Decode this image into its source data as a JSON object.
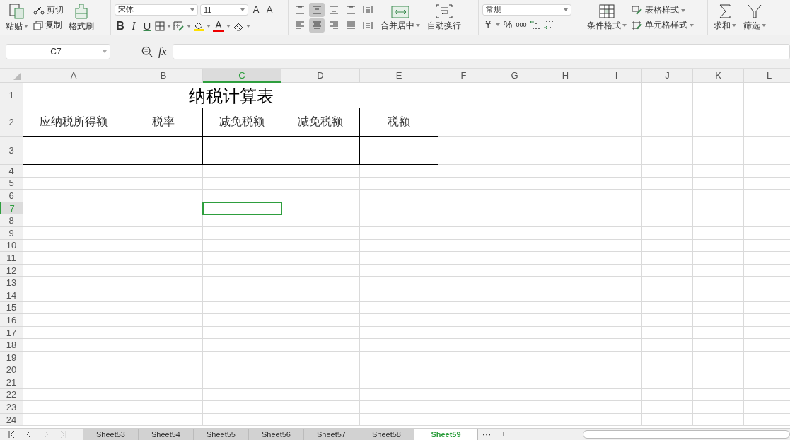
{
  "ribbon": {
    "paste": "粘贴",
    "cut": "剪切",
    "copy": "复制",
    "format_painter": "格式刷",
    "font_name": "宋体",
    "font_size": "11",
    "grow_font": "A",
    "shrink_font": "A",
    "bold": "B",
    "italic": "I",
    "underline": "U",
    "font_color": "A",
    "alignment": [
      {
        "selected": false
      },
      {
        "selected": true
      },
      {
        "selected": false
      },
      {
        "selected": false
      },
      {
        "selected": false
      },
      {
        "selected": false
      },
      {
        "selected": true
      },
      {
        "selected": false
      },
      {
        "selected": false
      },
      {
        "selected": false
      }
    ],
    "merge": "合并居中",
    "wrap": "自动换行",
    "number_format": "常规",
    "currency": "￥",
    "percent": "%",
    "thousands": "000",
    "conditional_format": "条件格式",
    "table_style": "表格样式",
    "cell_style": "单元格样式",
    "sum": "求和",
    "filter": "筛选"
  },
  "formula_bar": {
    "name_box": "C7",
    "fx": "fx"
  },
  "columns": [
    {
      "label": "A",
      "selected": false
    },
    {
      "label": "B",
      "selected": false
    },
    {
      "label": "C",
      "selected": true
    },
    {
      "label": "D",
      "selected": false
    },
    {
      "label": "E",
      "selected": false
    },
    {
      "label": "F",
      "selected": false
    },
    {
      "label": "G",
      "selected": false
    },
    {
      "label": "H",
      "selected": false
    },
    {
      "label": "I",
      "selected": false
    },
    {
      "label": "J",
      "selected": false
    },
    {
      "label": "K",
      "selected": false
    },
    {
      "label": "L",
      "selected": false
    }
  ],
  "rows": [
    {
      "label": "1",
      "selected": false
    },
    {
      "label": "2",
      "selected": false
    },
    {
      "label": "3",
      "selected": false
    },
    {
      "label": "4",
      "selected": false
    },
    {
      "label": "5",
      "selected": false
    },
    {
      "label": "6",
      "selected": false
    },
    {
      "label": "7",
      "selected": true
    },
    {
      "label": "8",
      "selected": false
    },
    {
      "label": "9",
      "selected": false
    },
    {
      "label": "10",
      "selected": false
    },
    {
      "label": "11",
      "selected": false
    },
    {
      "label": "12",
      "selected": false
    },
    {
      "label": "13",
      "selected": false
    },
    {
      "label": "14",
      "selected": false
    },
    {
      "label": "15",
      "selected": false
    },
    {
      "label": "16",
      "selected": false
    },
    {
      "label": "17",
      "selected": false
    },
    {
      "label": "18",
      "selected": false
    },
    {
      "label": "19",
      "selected": false
    },
    {
      "label": "20",
      "selected": false
    },
    {
      "label": "21",
      "selected": false
    },
    {
      "label": "22",
      "selected": false
    },
    {
      "label": "23",
      "selected": false
    },
    {
      "label": "24",
      "selected": false
    }
  ],
  "sheet_table": {
    "title": "纳税计算表",
    "headers": [
      "应纳税所得额",
      "税率",
      "减免税额",
      "减免税额",
      "税额"
    ]
  },
  "sheets": [
    {
      "label": "Sheet53",
      "selected": false
    },
    {
      "label": "Sheet54",
      "selected": false
    },
    {
      "label": "Sheet55",
      "selected": false
    },
    {
      "label": "Sheet56",
      "selected": false
    },
    {
      "label": "Sheet57",
      "selected": false
    },
    {
      "label": "Sheet58",
      "selected": false
    },
    {
      "label": "Sheet59",
      "selected": true
    }
  ],
  "sheet_more": "···",
  "sheet_add": "+"
}
